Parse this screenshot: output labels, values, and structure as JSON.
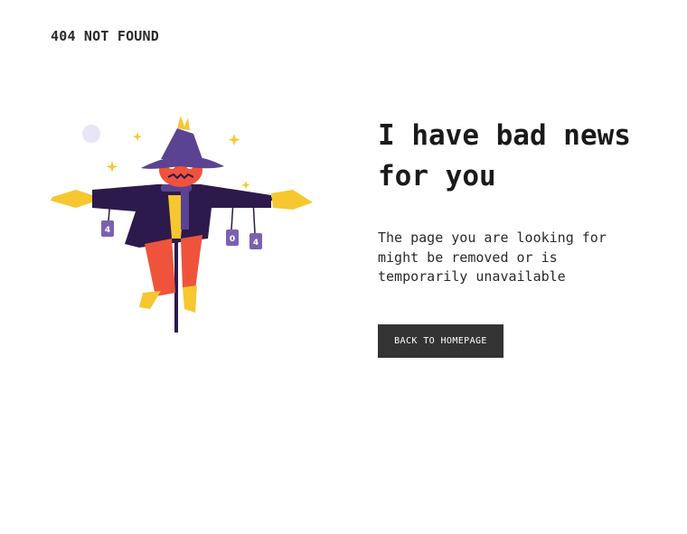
{
  "brand": {
    "title": "404 NOT FOUND"
  },
  "illustration": {
    "can_labels": [
      "4",
      "0",
      "4"
    ],
    "colors": {
      "coat": "#2c1a4d",
      "hat": "#5b4393",
      "face": "#f0533c",
      "straw": "#f6c72f",
      "pants": "#f0533c",
      "moon": "#e8e6f4"
    }
  },
  "main": {
    "headline": "I have bad news for you",
    "message": "The page you are looking for might be removed or is temporarily unavailable",
    "button_label": "BACK TO HOMEPAGE"
  },
  "colors": {
    "button_bg": "#333333",
    "button_text": "#ffffff",
    "text": "#1a1a1a"
  }
}
